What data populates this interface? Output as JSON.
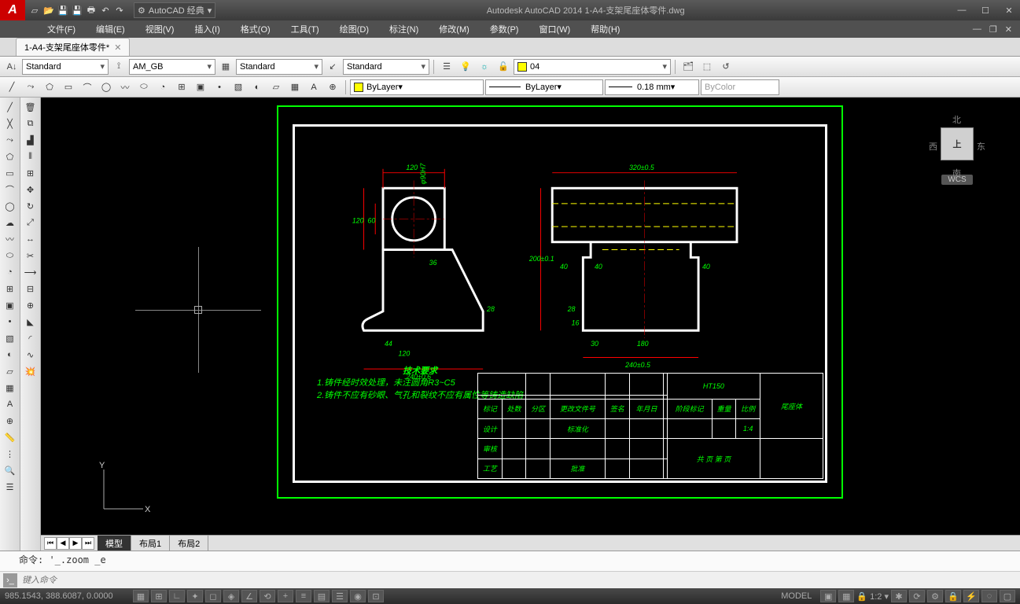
{
  "app": {
    "title": "Autodesk AutoCAD 2014   1-A4-支架尾座体零件.dwg",
    "workspace_label": "AutoCAD 经典"
  },
  "menu": {
    "file": "文件(F)",
    "edit": "编辑(E)",
    "view": "视图(V)",
    "insert": "插入(I)",
    "format": "格式(O)",
    "tools": "工具(T)",
    "draw": "绘图(D)",
    "dimension": "标注(N)",
    "modify": "修改(M)",
    "param": "参数(P)",
    "window": "窗口(W)",
    "help": "帮助(H)"
  },
  "doctab": {
    "name": "1-A4-支架尾座体零件*"
  },
  "style": {
    "text": "Standard",
    "dim": "AM_GB",
    "table": "Standard",
    "ml": "Standard"
  },
  "layer": {
    "current": "04"
  },
  "props": {
    "color": "ByLayer",
    "ltype": "ByLayer",
    "lweight": "0.18 mm",
    "plot": "ByColor"
  },
  "layout": {
    "model": "模型",
    "l1": "布局1",
    "l2": "布局2"
  },
  "cmd": {
    "history": "命令: '_.zoom _e",
    "placeholder": "键入命令"
  },
  "status": {
    "coords": "985.1543, 388.6087, 0.0000",
    "scale": "1:2"
  },
  "viewcube": {
    "n": "北",
    "s": "南",
    "e": "东",
    "w": "西",
    "top": "上",
    "wcs": "WCS"
  },
  "drawing": {
    "tech_title": "技术要求",
    "tech1": "1.铸件经时效处理，未注圆角R3~C5",
    "tech2": "2.铸件不应有砂眼、气孔和裂纹不应有属性等铸造缺陷",
    "dims": {
      "d1": "120",
      "d2": "120",
      "d3": "60",
      "d4": "36",
      "d5": "28",
      "d6": "44",
      "d7": "120",
      "d8": "240±0.6",
      "d9": "320±0.5",
      "d10": "200±0.1",
      "d11": "40",
      "d12": "40",
      "d13": "40",
      "d14": "28",
      "d15": "16",
      "d16": "30",
      "d17": "180",
      "d18": "240±0.5",
      "phi": "φ90H7"
    },
    "tb": {
      "material": "HT150",
      "name": "尾座体",
      "r1": "标记",
      "r2": "处数",
      "r3": "分区",
      "r4": "更改文件号",
      "r5": "签名",
      "r6": "年月日",
      "r7": "设计",
      "r8": "标准化",
      "r9": "审核",
      "r10": "工艺",
      "r11": "批准",
      "r12": "阶段标记",
      "r13": "重量",
      "r14": "比例",
      "r15": "1:4",
      "r16": "共   页 第   页"
    }
  }
}
